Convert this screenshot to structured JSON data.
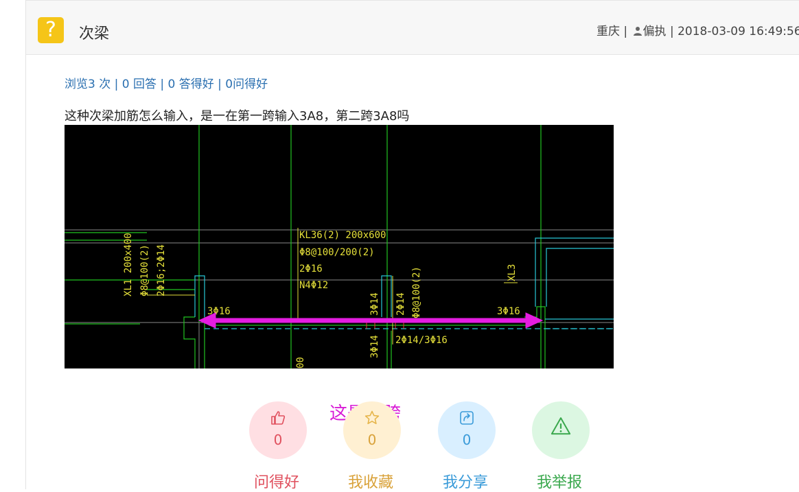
{
  "header": {
    "icon": "question-mark-icon",
    "icon_glyph": "?",
    "title": "次梁",
    "location": "重庆",
    "sep1": " | ",
    "user_icon": "user-icon",
    "username": "偏执",
    "sep2": " | ",
    "datetime": "2018-03-09 16:49:56"
  },
  "stats": {
    "text": "浏览3 次 | 0 回答 | 0 答得好 | 0问得好"
  },
  "question": {
    "body": "这种次梁加筋怎么输入，是一在第一跨输入3A8，第二跨3A8吗"
  },
  "cad_image": {
    "labels": {
      "kl36_name": "KL36(2) 200x600",
      "kl36_stirrup": "Φ8@100/200(2)",
      "kl36_top": "2Φ16",
      "kl36_side": "N4Φ12",
      "xl1_name": "XL1 200x400",
      "xl1_stirrup": "Φ8@100(2)",
      "xl1_bars": "2Φ16;2Φ14",
      "left_support": "3Φ16",
      "right_support": "3Φ16",
      "mid_top": "3Φ14",
      "mid_bars": "2Φ14",
      "mid_stirrup": "Φ8@100(2)",
      "mid_bottom": "3Φ14",
      "mid_span": "2Φ14/3Φ16",
      "xl3": "XL3",
      "bottom_mark": "00"
    }
  },
  "annotation": "这是一跨",
  "actions": [
    {
      "name": "good-question-button",
      "icon": "thumbs-up-icon",
      "count": "0",
      "label": "问得好",
      "color": "#e0505e",
      "bg": "#ffdfe3"
    },
    {
      "name": "favorite-button",
      "icon": "star-icon",
      "count": "0",
      "label": "我收藏",
      "color": "#d9a23a",
      "bg": "#fff0d2"
    },
    {
      "name": "share-button",
      "icon": "share-icon",
      "count": "0",
      "label": "我分享",
      "color": "#3a9bd9",
      "bg": "#d9efff"
    },
    {
      "name": "report-button",
      "icon": "warning-icon",
      "count": "",
      "label": "我举报",
      "color": "#3aa84d",
      "bg": "#dcf7e2"
    }
  ],
  "colors": {
    "stats_link": "#2a6fb0",
    "annotation": "#d81cd6",
    "icon_bg": "#f5c518"
  }
}
